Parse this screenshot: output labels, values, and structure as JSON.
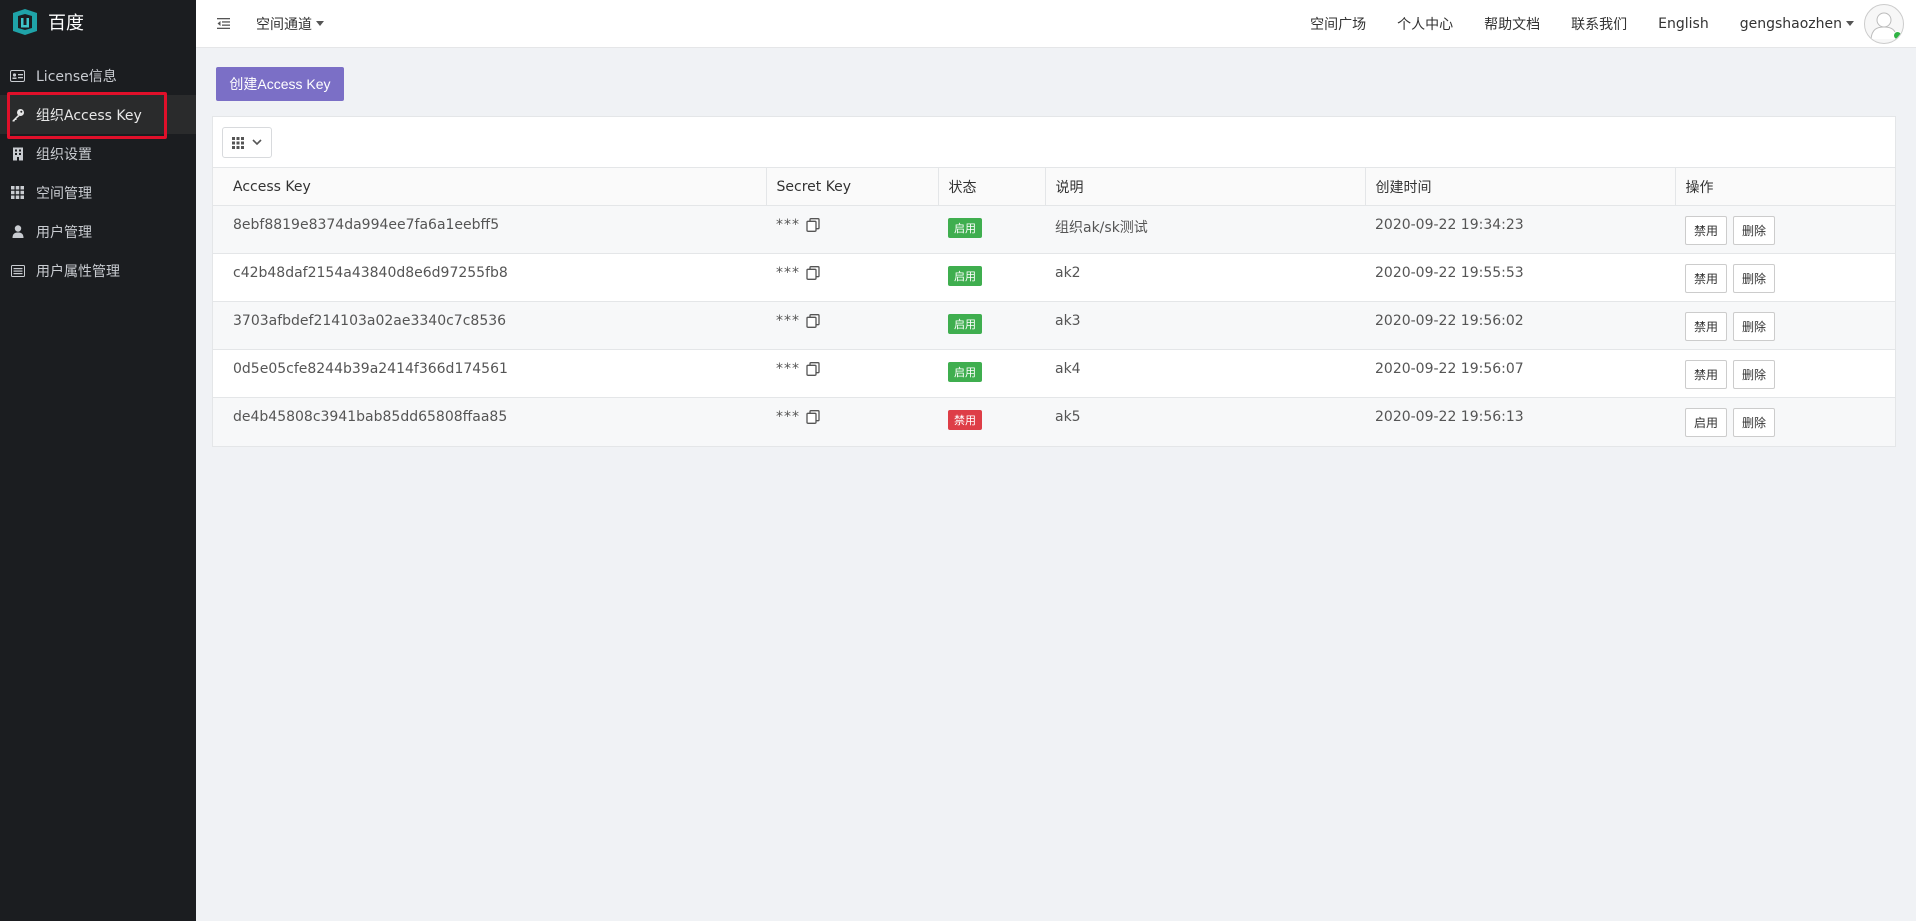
{
  "brand": {
    "name": "百度"
  },
  "sidebar": {
    "items": [
      {
        "label": "License信息",
        "icon": "id-card-icon"
      },
      {
        "label": "组织Access Key",
        "icon": "key-icon"
      },
      {
        "label": "组织设置",
        "icon": "building-icon"
      },
      {
        "label": "空间管理",
        "icon": "grid-icon"
      },
      {
        "label": "用户管理",
        "icon": "user-icon"
      },
      {
        "label": "用户属性管理",
        "icon": "list-icon"
      }
    ],
    "active_index": 1
  },
  "topbar": {
    "space_select": "空间通道",
    "nav": [
      "空间广场",
      "个人中心",
      "帮助文档",
      "联系我们",
      "English"
    ],
    "username": "gengshaozhen"
  },
  "main": {
    "create_button": "创建Access Key",
    "table": {
      "headers": [
        "Access Key",
        "Secret Key",
        "状态",
        "说明",
        "创建时间",
        "操作"
      ],
      "secret_mask": "***",
      "rows": [
        {
          "access_key": "8ebf8819e8374da994ee7fa6a1eebff5",
          "status": "启用",
          "status_type": "on",
          "desc": "组织ak/sk测试",
          "created": "2020-09-22 19:34:23",
          "toggle": "禁用",
          "delete": "删除"
        },
        {
          "access_key": "c42b48daf2154a43840d8e6d97255fb8",
          "status": "启用",
          "status_type": "on",
          "desc": "ak2",
          "created": "2020-09-22 19:55:53",
          "toggle": "禁用",
          "delete": "删除"
        },
        {
          "access_key": "3703afbdef214103a02ae3340c7c8536",
          "status": "启用",
          "status_type": "on",
          "desc": "ak3",
          "created": "2020-09-22 19:56:02",
          "toggle": "禁用",
          "delete": "删除"
        },
        {
          "access_key": "0d5e05cfe8244b39a2414f366d174561",
          "status": "启用",
          "status_type": "on",
          "desc": "ak4",
          "created": "2020-09-22 19:56:07",
          "toggle": "禁用",
          "delete": "删除"
        },
        {
          "access_key": "de4b45808c3941bab85dd65808ffaa85",
          "status": "禁用",
          "status_type": "off",
          "desc": "ak5",
          "created": "2020-09-22 19:56:13",
          "toggle": "启用",
          "delete": "删除"
        }
      ]
    }
  },
  "colors": {
    "sidebar_bg": "#1b1d20",
    "primary_button": "#7b6fc6",
    "status_on": "#3fae4f",
    "status_off": "#de3e47",
    "highlight_box": "#e0102a"
  }
}
